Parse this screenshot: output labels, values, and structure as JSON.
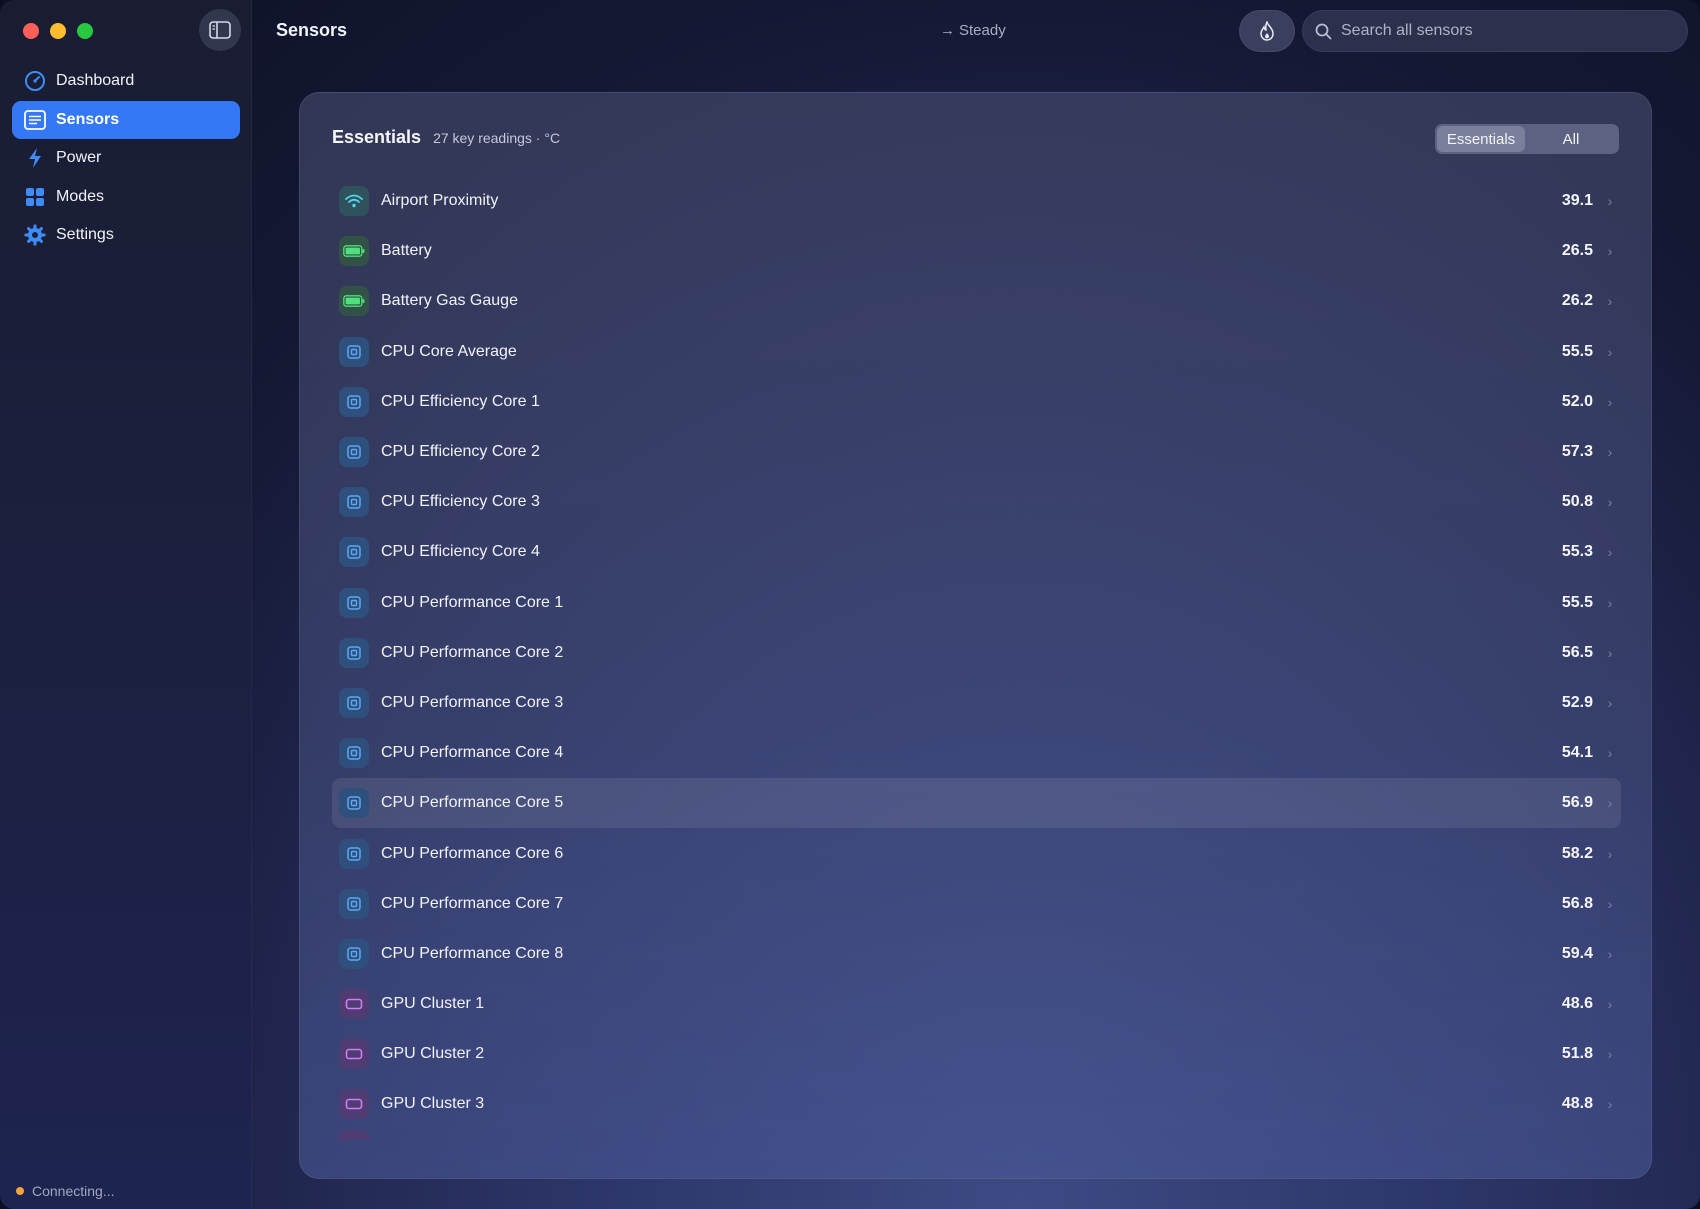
{
  "window": {
    "title": "Sensors"
  },
  "sidebar": {
    "items": [
      {
        "label": "Dashboard",
        "icon": "gauge-icon",
        "active": false
      },
      {
        "label": "Sensors",
        "icon": "list-icon",
        "active": true
      },
      {
        "label": "Power",
        "icon": "bolt-icon",
        "active": false
      },
      {
        "label": "Modes",
        "icon": "grid-icon",
        "active": false
      },
      {
        "label": "Settings",
        "icon": "gear-icon",
        "active": false
      }
    ],
    "status": "Connecting..."
  },
  "header": {
    "title": "Sensors",
    "trend": "Steady",
    "search_placeholder": "Search all sensors"
  },
  "panel": {
    "title": "Essentials",
    "subtitle": "27 key readings · °C",
    "segments": [
      "Essentials",
      "All"
    ],
    "selected_segment": "Essentials",
    "rows": [
      {
        "name": "Airport Proximity",
        "value": "39.1",
        "kind": "wifi"
      },
      {
        "name": "Battery",
        "value": "26.5",
        "kind": "battery"
      },
      {
        "name": "Battery Gas Gauge",
        "value": "26.2",
        "kind": "battery"
      },
      {
        "name": "CPU Core Average",
        "value": "55.5",
        "kind": "cpu"
      },
      {
        "name": "CPU Efficiency Core 1",
        "value": "52.0",
        "kind": "cpu"
      },
      {
        "name": "CPU Efficiency Core 2",
        "value": "57.3",
        "kind": "cpu"
      },
      {
        "name": "CPU Efficiency Core 3",
        "value": "50.8",
        "kind": "cpu"
      },
      {
        "name": "CPU Efficiency Core 4",
        "value": "55.3",
        "kind": "cpu"
      },
      {
        "name": "CPU Performance Core 1",
        "value": "55.5",
        "kind": "cpu"
      },
      {
        "name": "CPU Performance Core 2",
        "value": "56.5",
        "kind": "cpu"
      },
      {
        "name": "CPU Performance Core 3",
        "value": "52.9",
        "kind": "cpu"
      },
      {
        "name": "CPU Performance Core 4",
        "value": "54.1",
        "kind": "cpu"
      },
      {
        "name": "CPU Performance Core 5",
        "value": "56.9",
        "kind": "cpu",
        "highlighted": true
      },
      {
        "name": "CPU Performance Core 6",
        "value": "58.2",
        "kind": "cpu"
      },
      {
        "name": "CPU Performance Core 7",
        "value": "56.8",
        "kind": "cpu"
      },
      {
        "name": "CPU Performance Core 8",
        "value": "59.4",
        "kind": "cpu"
      },
      {
        "name": "GPU Cluster 1",
        "value": "48.6",
        "kind": "gpu"
      },
      {
        "name": "GPU Cluster 2",
        "value": "51.8",
        "kind": "gpu"
      },
      {
        "name": "GPU Cluster 3",
        "value": "48.8",
        "kind": "gpu"
      }
    ]
  },
  "colors": {
    "accent": "#3478f6",
    "status_dot": "#f0a43a",
    "wifi_icon": "#4fd7e8",
    "battery_icon": "#4ee07a",
    "cpu_icon": "#5aa9f5",
    "gpu_icon": "#d27cf2"
  }
}
